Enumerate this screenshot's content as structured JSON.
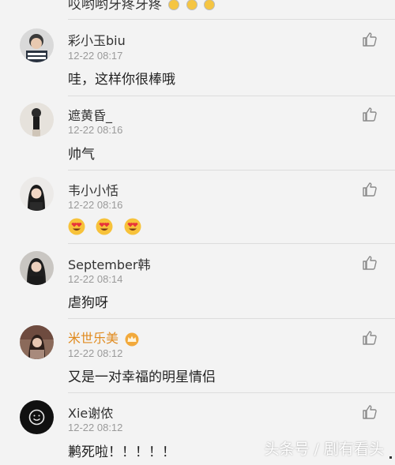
{
  "top": {
    "text": "哎哟哟牙疼牙疼"
  },
  "comments": [
    {
      "user": "彩小玉biu",
      "time": "12-22 08:17",
      "text": "哇，这样你很棒哦"
    },
    {
      "user": "遮黄昏_",
      "time": "12-22 08:16",
      "text": "帅气"
    },
    {
      "user": "韦小小恬",
      "time": "12-22 08:16",
      "text": ""
    },
    {
      "user": "September韩",
      "time": "12-22 08:14",
      "text": "虐狗呀"
    },
    {
      "user": "米世乐美",
      "time": "12-22 08:12",
      "text": "又是一对幸福的明星情侣"
    },
    {
      "user": "Xie谢侬",
      "time": "12-22 08:12",
      "text": "鹣死啦！！！！！"
    }
  ],
  "watermark": "头条号 / 剧有看头",
  "colors": {
    "vip_name": "#e08a1e",
    "time": "#9a9a9a",
    "divider": "#dcdcdc"
  }
}
